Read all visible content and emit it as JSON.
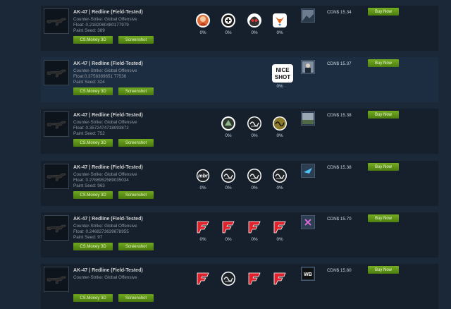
{
  "buttons": {
    "cs_money": "CS.Money 3D",
    "screenshot": "Screenshot",
    "buy": "Buy Now"
  },
  "listings": [
    {
      "title": "AK-47 | Redline (Field-Tested)",
      "game": "Counter-Strike: Global Offensive",
      "float": "Float: 0.2182060480177979",
      "seed": "Paint Seed: 389",
      "price": "CDN$ 15.34",
      "stickers": [
        {
          "icon": "portrait-sticker",
          "pct": "0%"
        },
        {
          "icon": "round-logo-sticker",
          "pct": "0%"
        },
        {
          "icon": "skull-sticker",
          "pct": "0%"
        },
        {
          "icon": "fox-sticker",
          "pct": "0%"
        }
      ],
      "charm": "landscape-charm"
    },
    {
      "title": "AK-47 | Redline (Field-Tested)",
      "game": "Counter-Strike: Global Offensive",
      "float": "Float: 0.3758389651 77536",
      "seed": "Paint Seed: 324",
      "price": "CDN$ 15.37",
      "stickers": [
        {
          "icon": "nice-shot-sticker",
          "pct": "0%",
          "text": "NICE SHOT"
        }
      ],
      "charm": "person-charm"
    },
    {
      "title": "AK-47 | Redline (Field-Tested)",
      "game": "Counter-Strike: Global Offensive",
      "float": "Float: 0.3572474718093872",
      "seed": "Paint Seed: 752",
      "price": "CDN$ 15.38",
      "stickers": [
        {
          "icon": "round-team-sticker",
          "pct": "0%"
        },
        {
          "icon": "signature-sticker",
          "pct": "0%"
        },
        {
          "icon": "gold-signature-sticker",
          "pct": "0%"
        }
      ],
      "charm": "desert-charm"
    },
    {
      "title": "AK-47 | Redline (Field-Tested)",
      "game": "Counter-Strike: Global Offensive",
      "float": "Float: 0.2788952589035034",
      "seed": "Paint Seed: 963",
      "price": "CDN$ 15.38",
      "stickers": [
        {
          "icon": "mibr-sticker",
          "pct": "0%",
          "text": "mbr"
        },
        {
          "icon": "signature-sticker",
          "pct": "0%"
        },
        {
          "icon": "signature-sticker",
          "pct": "0%"
        },
        {
          "icon": "signature-sticker",
          "pct": "0%"
        }
      ],
      "charm": "blue-bird-charm"
    },
    {
      "title": "AK-47 | Redline (Field-Tested)",
      "game": "Counter-Strike: Global Offensive",
      "float": "Float: 0.2468273639678955",
      "seed": "Paint Seed: 97",
      "price": "CDN$ 15.70",
      "stickers": [
        {
          "icon": "faze-sticker",
          "pct": "0%"
        },
        {
          "icon": "faze-sticker",
          "pct": "0%"
        },
        {
          "icon": "faze-sticker",
          "pct": "0%"
        },
        {
          "icon": "faze-sticker",
          "pct": "0%"
        }
      ],
      "charm": "purple-charm"
    },
    {
      "title": "AK-47 | Redline (Field-Tested)",
      "game": "Counter-Strike: Global Offensive",
      "float": "",
      "seed": "",
      "price": "CDN$ 15.80",
      "stickers": [
        {
          "icon": "faze-sticker",
          "pct": ""
        },
        {
          "icon": "signature-sticker",
          "pct": ""
        },
        {
          "icon": "faze-sticker",
          "pct": ""
        },
        {
          "icon": "faze-sticker",
          "pct": ""
        }
      ],
      "charm": "wb-charm"
    }
  ]
}
